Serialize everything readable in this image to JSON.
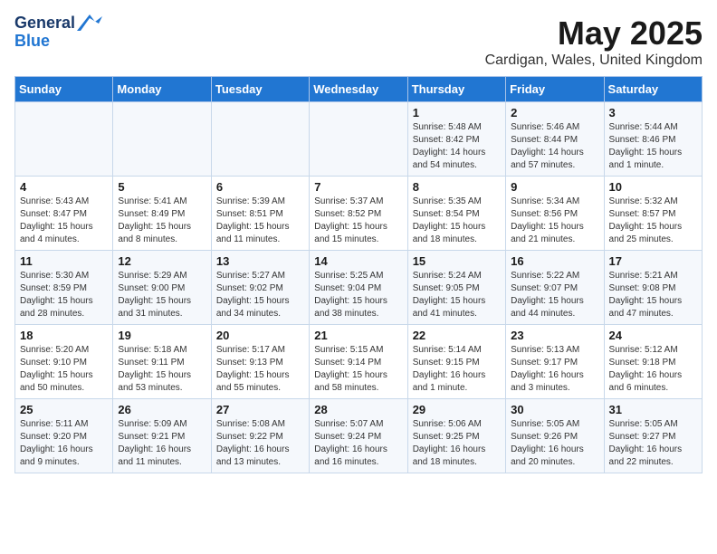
{
  "header": {
    "logo_line1": "General",
    "logo_line2": "Blue",
    "title": "May 2025",
    "subtitle": "Cardigan, Wales, United Kingdom"
  },
  "days_of_week": [
    "Sunday",
    "Monday",
    "Tuesday",
    "Wednesday",
    "Thursday",
    "Friday",
    "Saturday"
  ],
  "weeks": [
    [
      {
        "num": "",
        "detail": ""
      },
      {
        "num": "",
        "detail": ""
      },
      {
        "num": "",
        "detail": ""
      },
      {
        "num": "",
        "detail": ""
      },
      {
        "num": "1",
        "detail": "Sunrise: 5:48 AM\nSunset: 8:42 PM\nDaylight: 14 hours\nand 54 minutes."
      },
      {
        "num": "2",
        "detail": "Sunrise: 5:46 AM\nSunset: 8:44 PM\nDaylight: 14 hours\nand 57 minutes."
      },
      {
        "num": "3",
        "detail": "Sunrise: 5:44 AM\nSunset: 8:46 PM\nDaylight: 15 hours\nand 1 minute."
      }
    ],
    [
      {
        "num": "4",
        "detail": "Sunrise: 5:43 AM\nSunset: 8:47 PM\nDaylight: 15 hours\nand 4 minutes."
      },
      {
        "num": "5",
        "detail": "Sunrise: 5:41 AM\nSunset: 8:49 PM\nDaylight: 15 hours\nand 8 minutes."
      },
      {
        "num": "6",
        "detail": "Sunrise: 5:39 AM\nSunset: 8:51 PM\nDaylight: 15 hours\nand 11 minutes."
      },
      {
        "num": "7",
        "detail": "Sunrise: 5:37 AM\nSunset: 8:52 PM\nDaylight: 15 hours\nand 15 minutes."
      },
      {
        "num": "8",
        "detail": "Sunrise: 5:35 AM\nSunset: 8:54 PM\nDaylight: 15 hours\nand 18 minutes."
      },
      {
        "num": "9",
        "detail": "Sunrise: 5:34 AM\nSunset: 8:56 PM\nDaylight: 15 hours\nand 21 minutes."
      },
      {
        "num": "10",
        "detail": "Sunrise: 5:32 AM\nSunset: 8:57 PM\nDaylight: 15 hours\nand 25 minutes."
      }
    ],
    [
      {
        "num": "11",
        "detail": "Sunrise: 5:30 AM\nSunset: 8:59 PM\nDaylight: 15 hours\nand 28 minutes."
      },
      {
        "num": "12",
        "detail": "Sunrise: 5:29 AM\nSunset: 9:00 PM\nDaylight: 15 hours\nand 31 minutes."
      },
      {
        "num": "13",
        "detail": "Sunrise: 5:27 AM\nSunset: 9:02 PM\nDaylight: 15 hours\nand 34 minutes."
      },
      {
        "num": "14",
        "detail": "Sunrise: 5:25 AM\nSunset: 9:04 PM\nDaylight: 15 hours\nand 38 minutes."
      },
      {
        "num": "15",
        "detail": "Sunrise: 5:24 AM\nSunset: 9:05 PM\nDaylight: 15 hours\nand 41 minutes."
      },
      {
        "num": "16",
        "detail": "Sunrise: 5:22 AM\nSunset: 9:07 PM\nDaylight: 15 hours\nand 44 minutes."
      },
      {
        "num": "17",
        "detail": "Sunrise: 5:21 AM\nSunset: 9:08 PM\nDaylight: 15 hours\nand 47 minutes."
      }
    ],
    [
      {
        "num": "18",
        "detail": "Sunrise: 5:20 AM\nSunset: 9:10 PM\nDaylight: 15 hours\nand 50 minutes."
      },
      {
        "num": "19",
        "detail": "Sunrise: 5:18 AM\nSunset: 9:11 PM\nDaylight: 15 hours\nand 53 minutes."
      },
      {
        "num": "20",
        "detail": "Sunrise: 5:17 AM\nSunset: 9:13 PM\nDaylight: 15 hours\nand 55 minutes."
      },
      {
        "num": "21",
        "detail": "Sunrise: 5:15 AM\nSunset: 9:14 PM\nDaylight: 15 hours\nand 58 minutes."
      },
      {
        "num": "22",
        "detail": "Sunrise: 5:14 AM\nSunset: 9:15 PM\nDaylight: 16 hours\nand 1 minute."
      },
      {
        "num": "23",
        "detail": "Sunrise: 5:13 AM\nSunset: 9:17 PM\nDaylight: 16 hours\nand 3 minutes."
      },
      {
        "num": "24",
        "detail": "Sunrise: 5:12 AM\nSunset: 9:18 PM\nDaylight: 16 hours\nand 6 minutes."
      }
    ],
    [
      {
        "num": "25",
        "detail": "Sunrise: 5:11 AM\nSunset: 9:20 PM\nDaylight: 16 hours\nand 9 minutes."
      },
      {
        "num": "26",
        "detail": "Sunrise: 5:09 AM\nSunset: 9:21 PM\nDaylight: 16 hours\nand 11 minutes."
      },
      {
        "num": "27",
        "detail": "Sunrise: 5:08 AM\nSunset: 9:22 PM\nDaylight: 16 hours\nand 13 minutes."
      },
      {
        "num": "28",
        "detail": "Sunrise: 5:07 AM\nSunset: 9:24 PM\nDaylight: 16 hours\nand 16 minutes."
      },
      {
        "num": "29",
        "detail": "Sunrise: 5:06 AM\nSunset: 9:25 PM\nDaylight: 16 hours\nand 18 minutes."
      },
      {
        "num": "30",
        "detail": "Sunrise: 5:05 AM\nSunset: 9:26 PM\nDaylight: 16 hours\nand 20 minutes."
      },
      {
        "num": "31",
        "detail": "Sunrise: 5:05 AM\nSunset: 9:27 PM\nDaylight: 16 hours\nand 22 minutes."
      }
    ]
  ]
}
